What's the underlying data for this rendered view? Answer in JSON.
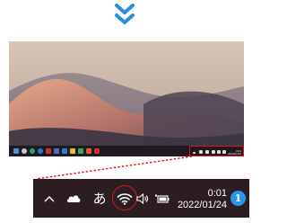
{
  "zoomed_tray": {
    "ime_label": "あ",
    "clock_time": "0:01",
    "clock_date": "2022/01/24",
    "notification_count": "1",
    "icons": [
      "chevron-up-icon",
      "cloud-icon",
      "ime-icon",
      "wifi-icon",
      "volume-icon",
      "battery-icon",
      "notification-icon"
    ]
  },
  "mini_tray": {
    "clock_time": "0:01",
    "clock_date": "2022/01/24"
  },
  "colors": {
    "highlight": "#e0141b",
    "arrow": "#2b8fd8",
    "taskbar": "#2b1d22",
    "badge": "#2b95e8"
  }
}
